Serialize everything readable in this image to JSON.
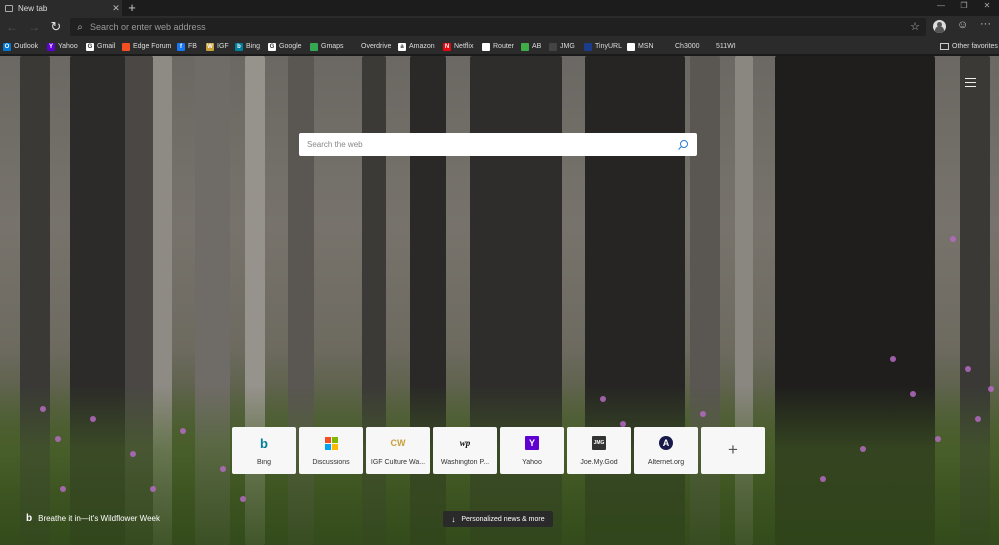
{
  "tab": {
    "title": "New tab"
  },
  "window_controls": {
    "minimize": "—",
    "restore": "❐",
    "close": "✕"
  },
  "address_bar": {
    "placeholder": "Search or enter web address"
  },
  "favorites": [
    {
      "label": "Outlook",
      "icon": "outlook-icon",
      "color": "#0078d4",
      "glyph": "O"
    },
    {
      "label": "Yahoo",
      "icon": "yahoo-icon",
      "color": "#5f01d1",
      "glyph": "Y"
    },
    {
      "label": "Gmail",
      "icon": "gmail-icon",
      "color": "#ffffff",
      "glyph": "G"
    },
    {
      "label": "Edge Forum",
      "icon": "edge-forum-icon",
      "color": "#f25022",
      "glyph": ""
    },
    {
      "label": "FB",
      "icon": "facebook-icon",
      "color": "#1877f2",
      "glyph": "f"
    },
    {
      "label": "IGF",
      "icon": "igf-icon",
      "color": "#c8a03c",
      "glyph": "W"
    },
    {
      "label": "Bing",
      "icon": "bing-icon",
      "color": "#00809d",
      "glyph": "b"
    },
    {
      "label": "Google",
      "icon": "google-icon",
      "color": "#ffffff",
      "glyph": "G"
    },
    {
      "label": "Gmaps",
      "icon": "gmaps-icon",
      "color": "#34a853",
      "glyph": ""
    },
    {
      "label": "Overdrive",
      "icon": "overdrive-icon",
      "color": "#2b2b2b",
      "glyph": ""
    },
    {
      "label": "Amazon",
      "icon": "amazon-icon",
      "color": "#ffffff",
      "glyph": "a"
    },
    {
      "label": "Netflix",
      "icon": "netflix-icon",
      "color": "#e50914",
      "glyph": "N"
    },
    {
      "label": "Router",
      "icon": "router-icon",
      "color": "#ffffff",
      "glyph": ""
    },
    {
      "label": "AB",
      "icon": "ab-icon",
      "color": "#3fae49",
      "glyph": ""
    },
    {
      "label": "JMG",
      "icon": "jmg-icon",
      "color": "#444444",
      "glyph": ""
    },
    {
      "label": "TinyURL",
      "icon": "tinyurl-icon",
      "color": "#1b3b8b",
      "glyph": ""
    },
    {
      "label": "MSN",
      "icon": "msn-icon",
      "color": "#ffffff",
      "glyph": ""
    },
    {
      "label": "Ch3000",
      "icon": "ch3000-icon",
      "color": "#2b2b2b",
      "glyph": ""
    },
    {
      "label": "511WI",
      "icon": "511wi-icon",
      "color": "#2b2b2b",
      "glyph": ""
    }
  ],
  "other_favorites": "Other favorites",
  "search": {
    "placeholder": "Search the web"
  },
  "quick_links": [
    {
      "label": "Bing",
      "icon": "bing-icon",
      "color": "#00809d",
      "glyph": "b"
    },
    {
      "label": "Discussions",
      "icon": "microsoft-icon",
      "color": "#f25022",
      "glyph": ""
    },
    {
      "label": "IGF Culture Wa...",
      "icon": "igf-cw-icon",
      "color": "#c8a03c",
      "glyph": "CW"
    },
    {
      "label": "Washington P...",
      "icon": "washington-post-icon",
      "color": "#111111",
      "glyph": "wp"
    },
    {
      "label": "Yahoo",
      "icon": "yahoo-icon",
      "color": "#5f01d1",
      "glyph": "Y"
    },
    {
      "label": "Joe.My.God",
      "icon": "joemygod-icon",
      "color": "#333333",
      "glyph": "JMG"
    },
    {
      "label": "Alternet.org",
      "icon": "alternet-icon",
      "color": "#1a1a4a",
      "glyph": "A"
    }
  ],
  "add_tile": "+",
  "image_caption": "Breathe it in—it's Wildflower Week",
  "news_button": "Personalized news & more"
}
